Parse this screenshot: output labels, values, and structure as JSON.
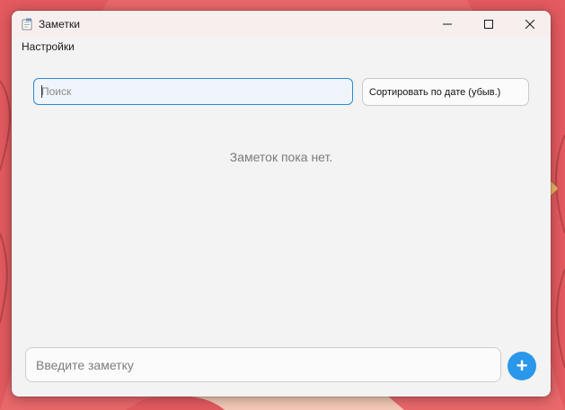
{
  "window": {
    "title": "Заметки",
    "icon": "notepad-icon",
    "controls": [
      "minimize-icon",
      "maximize-icon",
      "close-icon"
    ]
  },
  "menu": {
    "items": [
      {
        "label": "Настройки"
      }
    ]
  },
  "search": {
    "placeholder": "Поиск",
    "value": ""
  },
  "sort": {
    "selected": "Сортировать по дате (убыв.)"
  },
  "notes": {
    "empty_text": "Заметок пока нет."
  },
  "composer": {
    "placeholder": "Введите заметку",
    "value": "",
    "add_label": "+",
    "add_icon": "plus-icon"
  },
  "colors": {
    "accent": "#2b97ea",
    "focus_border": "#2a8ad4",
    "window_bg": "#f3f3f3",
    "wallpaper": "#e9686a"
  }
}
